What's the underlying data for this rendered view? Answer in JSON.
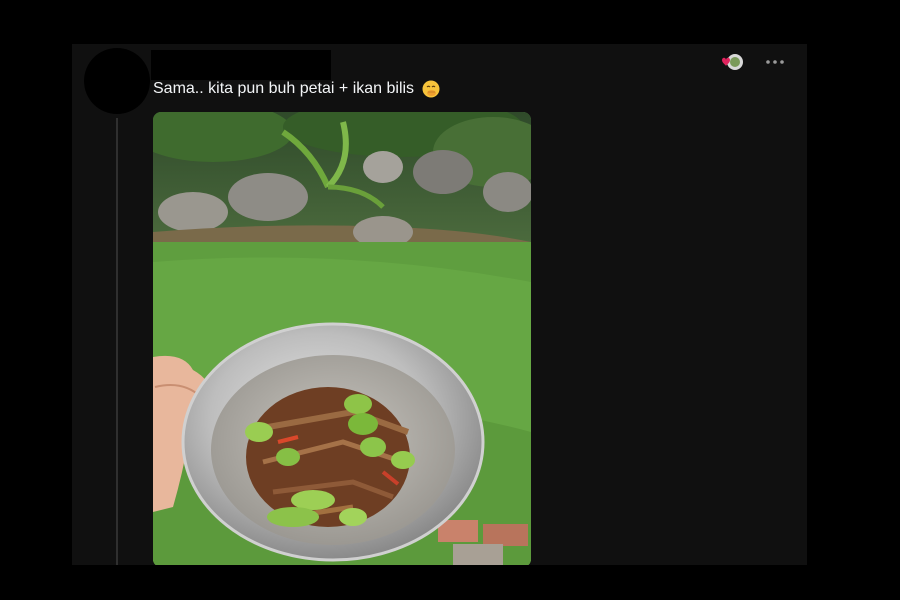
{
  "post": {
    "author_redacted": true,
    "text": "Sama.. kita pun buh petai + ikan bilis",
    "emoji": "face-with-hand-over-mouth-emoji",
    "reaction_icon": "heart-reaction-icon",
    "more_icon": "more-options-icon",
    "image": {
      "subject": "bowl of petai with ikan bilis held over grass by a stream"
    }
  },
  "colors": {
    "page_bg": "#000000",
    "card_bg": "#101010",
    "text": "#f3f5f7",
    "reaction_red": "#e0245e"
  }
}
